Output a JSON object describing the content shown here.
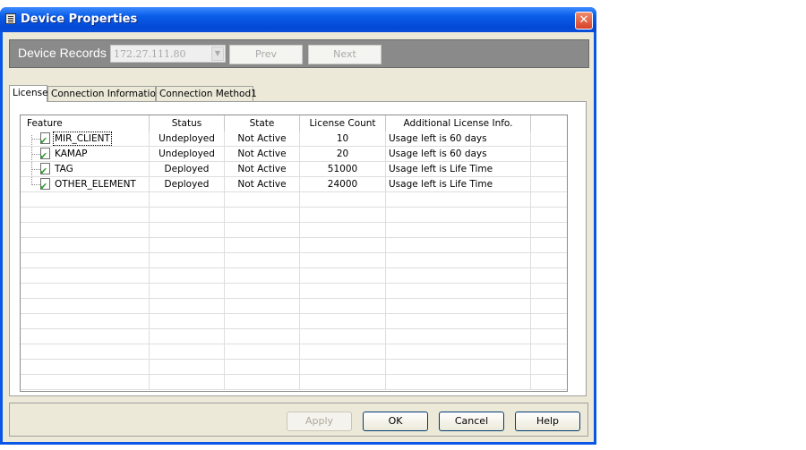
{
  "window": {
    "title": "Device Properties",
    "close_glyph": "✕"
  },
  "records": {
    "label": "Device Records",
    "ip": "172.27.111.80",
    "prev_label": "Prev",
    "next_label": "Next"
  },
  "tabs": [
    {
      "label": "License",
      "active": true
    },
    {
      "label": "Connection Information",
      "active": false
    },
    {
      "label": "Connection Method1",
      "active": false
    }
  ],
  "table": {
    "columns": [
      "Feature",
      "Status",
      "State",
      "License Count",
      "Additional License Info."
    ],
    "rows": [
      {
        "feature": "MIR_CLIENT",
        "status": "Undeployed",
        "state": "Not Active",
        "count": "10",
        "info": "Usage left is 60 days"
      },
      {
        "feature": "KAMAP",
        "status": "Undeployed",
        "state": "Not Active",
        "count": "20",
        "info": "Usage left is 60 days"
      },
      {
        "feature": "TAG",
        "status": "Deployed",
        "state": "Not Active",
        "count": "51000",
        "info": "Usage left is Life Time"
      },
      {
        "feature": "OTHER_ELEMENT",
        "status": "Deployed",
        "state": "Not Active",
        "count": "24000",
        "info": "Usage left is Life Time"
      }
    ]
  },
  "buttons": {
    "apply": "Apply",
    "ok": "OK",
    "cancel": "Cancel",
    "help": "Help"
  },
  "icons": {
    "feature_icon": "license-check-icon",
    "check_glyph": "✔"
  }
}
